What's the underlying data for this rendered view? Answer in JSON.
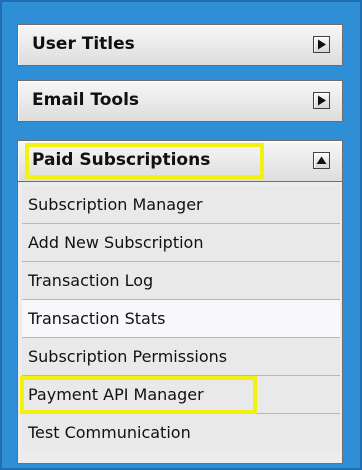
{
  "sections": [
    {
      "title": "User Titles",
      "state": "collapsed",
      "toggle_icon": "triangle-right-icon"
    },
    {
      "title": "Email Tools",
      "state": "collapsed",
      "toggle_icon": "triangle-right-icon"
    },
    {
      "title": "Paid Subscriptions",
      "state": "expanded",
      "toggle_icon": "triangle-up-icon"
    }
  ],
  "menu_items": [
    {
      "label": "Subscription Manager"
    },
    {
      "label": "Add New Subscription"
    },
    {
      "label": "Transaction Log"
    },
    {
      "label": "Transaction Stats",
      "active": true
    },
    {
      "label": "Subscription Permissions"
    },
    {
      "label": "Payment API Manager",
      "highlighted": true
    },
    {
      "label": "Test Communication"
    }
  ],
  "colors": {
    "frame_background": "#2f8fd6",
    "highlight": "#f2f20f",
    "panel_background": "#ececec"
  }
}
